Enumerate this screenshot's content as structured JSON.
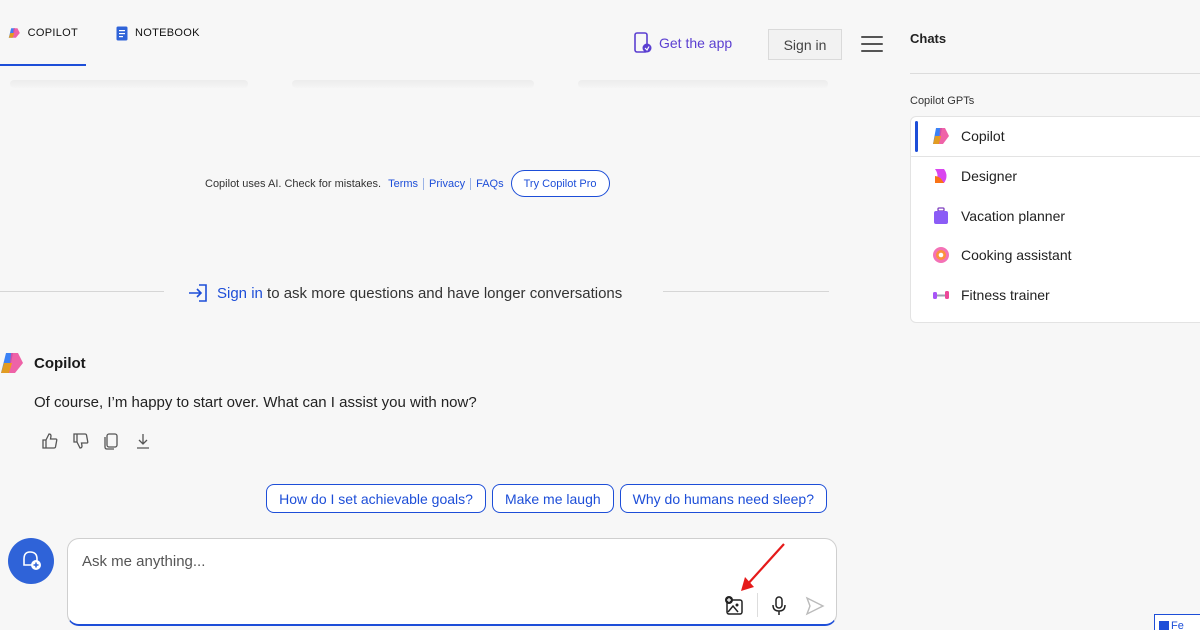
{
  "header": {
    "tabs": [
      {
        "label": "COPILOT",
        "active": true
      },
      {
        "label": "NOTEBOOK",
        "active": false
      }
    ],
    "get_app": "Get the app",
    "sign_in": "Sign in"
  },
  "disclaimer": {
    "text": "Copilot uses AI. Check for mistakes.",
    "links": [
      "Terms",
      "Privacy",
      "FAQs"
    ],
    "pro_button": "Try Copilot Pro"
  },
  "signin_prompt": {
    "link": "Sign in",
    "text": " to ask more questions and have longer conversations"
  },
  "message": {
    "author": "Copilot",
    "text": "Of course, I’m happy to start over. What can I assist you with now?"
  },
  "suggestions": [
    "How do I set achievable goals?",
    "Make me laugh",
    "Why do humans need sleep?"
  ],
  "input": {
    "placeholder": "Ask me anything..."
  },
  "sidebar": {
    "title": "Chats",
    "gpts_label": "Copilot GPTs",
    "gpts": [
      {
        "label": "Copilot",
        "icon": "copilot-icon",
        "active": true
      },
      {
        "label": "Designer",
        "icon": "designer-icon"
      },
      {
        "label": "Vacation planner",
        "icon": "luggage-icon"
      },
      {
        "label": "Cooking assistant",
        "icon": "donut-icon"
      },
      {
        "label": "Fitness trainer",
        "icon": "dumbbell-icon"
      }
    ]
  },
  "feedback": {
    "label": "Fe"
  },
  "colors": {
    "accent": "#1d4ed8",
    "brand_purple": "#5b3fd1",
    "background": "#f7f7f7"
  }
}
